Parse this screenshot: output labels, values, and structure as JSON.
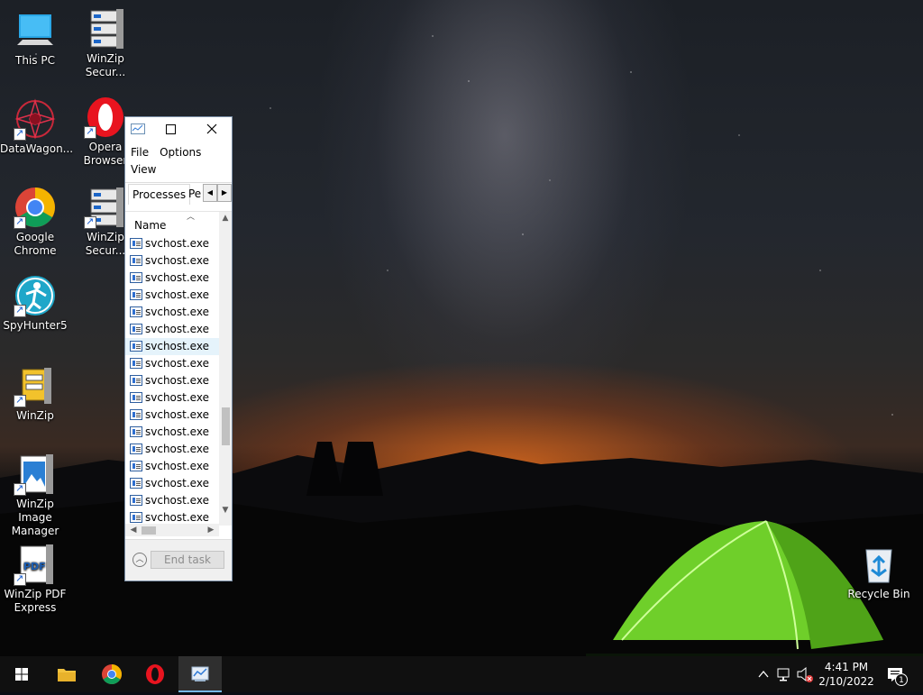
{
  "desktop": {
    "icons": [
      {
        "label": "This PC"
      },
      {
        "label": "WinZip Secur..."
      },
      {
        "label": "DataWagon..."
      },
      {
        "label": "Opera Browser"
      },
      {
        "label": "Google Chrome"
      },
      {
        "label": "WinZip Secur..."
      },
      {
        "label": "SpyHunter5"
      },
      {
        "label": "WinZip"
      },
      {
        "label": "WinZip Image Manager"
      },
      {
        "label": "WinZip PDF Express"
      },
      {
        "label": "Recycle Bin"
      }
    ]
  },
  "task_manager": {
    "menu": {
      "file": "File",
      "options": "Options",
      "view": "View"
    },
    "tabs": {
      "active": "Processes",
      "next": "Pe"
    },
    "column_header": "Name",
    "processes": [
      "svchost.exe",
      "svchost.exe",
      "svchost.exe",
      "svchost.exe",
      "svchost.exe",
      "svchost.exe",
      "svchost.exe",
      "svchost.exe",
      "svchost.exe",
      "svchost.exe",
      "svchost.exe",
      "svchost.exe",
      "svchost.exe",
      "svchost.exe",
      "svchost.exe",
      "svchost.exe",
      "svchost.exe"
    ],
    "selected_index": 6,
    "end_task_label": "End task"
  },
  "taskbar": {
    "time": "4:41 PM",
    "date": "2/10/2022",
    "notification_count": "1"
  },
  "colors": {
    "taskbar_bg": "#101010",
    "active_accent": "#76b9ed",
    "selection": "#e5f3fb"
  }
}
